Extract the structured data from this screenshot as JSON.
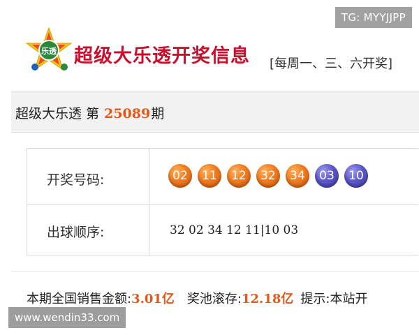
{
  "header": {
    "title": "超级大乐透开奖信息",
    "subtitle": "[每周一、三、六开奖]",
    "logo_text": "乐透"
  },
  "badge": {
    "tg": "TG: MYYJJPP"
  },
  "issue": {
    "prefix": "超级大乐透 第 ",
    "number": "25089",
    "suffix": "期"
  },
  "results": {
    "winning_label": "开奖号码:",
    "front_balls": [
      "02",
      "11",
      "12",
      "32",
      "34"
    ],
    "back_balls": [
      "03",
      "10"
    ],
    "order_label": "出球顺序:",
    "order_value": "32 02 34 12 11|10 03"
  },
  "summary": {
    "sales_label": "本期全国销售金额:",
    "sales_value": "3.01亿",
    "pool_label": "奖池滚存:",
    "pool_value": "12.18亿",
    "tip_label": "提示:本站开"
  },
  "watermark": {
    "text": "www.wendin33.com"
  },
  "colors": {
    "title_red": "#c8102e",
    "accent_orange": "#e2571a",
    "front_ball": "#f07a1e",
    "back_ball": "#5b56c9"
  }
}
